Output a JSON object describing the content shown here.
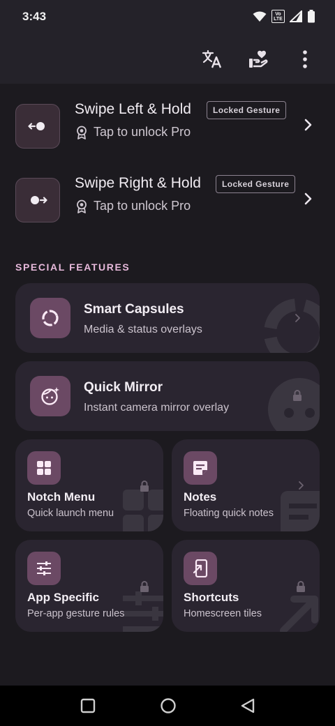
{
  "status_bar": {
    "time": "3:43",
    "icons": [
      "wifi-icon",
      "volte-icon",
      "signal-icon",
      "battery-icon"
    ],
    "volte_label": "Vo LTE"
  },
  "app_bar": {
    "actions": [
      "translate-icon",
      "donate-icon",
      "more-vert-icon"
    ]
  },
  "gestures": [
    {
      "title": "Swipe Left & Hold",
      "badge": "Locked Gesture",
      "subtitle": "Tap to unlock Pro",
      "icon": "swipe-left-icon"
    },
    {
      "title": "Swipe Right & Hold",
      "badge": "Locked Gesture",
      "subtitle": "Tap to unlock Pro",
      "icon": "swipe-right-icon"
    }
  ],
  "section": {
    "title": "SPECIAL FEATURES"
  },
  "features_large": [
    {
      "title": "Smart Capsules",
      "subtitle": "Media & status overlays",
      "icon": "capsule-icon",
      "trailing": "chevron-right-icon"
    },
    {
      "title": "Quick Mirror",
      "subtitle": "Instant camera mirror overlay",
      "icon": "face-icon",
      "trailing": "lock-icon"
    }
  ],
  "features_small": [
    {
      "title": "Notch Menu",
      "subtitle": "Quick launch menu",
      "icon": "grid-icon",
      "trailing": "lock-icon"
    },
    {
      "title": "Notes",
      "subtitle": "Floating quick notes",
      "icon": "note-icon",
      "trailing": "chevron-right-icon"
    },
    {
      "title": "App Specific",
      "subtitle": "Per-app gesture rules",
      "icon": "tune-icon",
      "trailing": "lock-icon"
    },
    {
      "title": "Shortcuts",
      "subtitle": "Homescreen tiles",
      "icon": "shortcut-icon",
      "trailing": "lock-icon"
    }
  ],
  "nav_bar": {
    "buttons": [
      "recents-icon",
      "home-icon",
      "back-icon"
    ]
  },
  "colors": {
    "background": "#1c1a1f",
    "app_bar": "#242229",
    "card": "#2a2530",
    "icon_tile": "#6b4964",
    "accent": "#e7b9db"
  }
}
